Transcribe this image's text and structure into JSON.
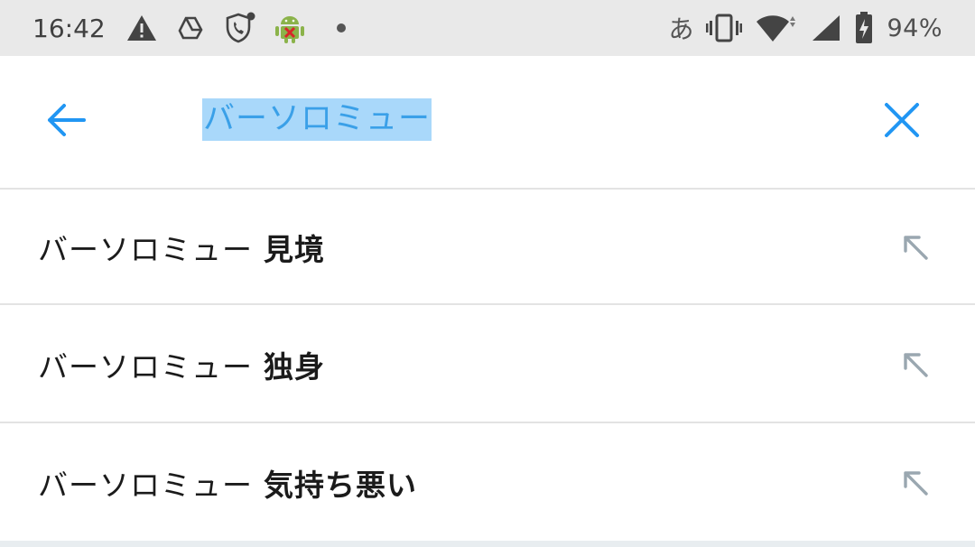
{
  "status_bar": {
    "time": "16:42",
    "left_icons": [
      "warning-icon",
      "drive-icon",
      "call-shield-icon",
      "android-debug-icon",
      "dot-icon"
    ],
    "ime_indicator": "あ",
    "right_icons": [
      "vibrate-icon",
      "wifi-icon",
      "signal-icon",
      "battery-charging-icon"
    ],
    "battery_percent": "94%"
  },
  "search": {
    "query": "バーソロミュー",
    "back_icon": "arrow-left-icon",
    "clear_icon": "close-icon",
    "accent_color": "#2196f3",
    "selection_color": "#a9d8fa"
  },
  "suggestions": [
    {
      "base": "バーソロミュー",
      "suffix": "見境",
      "fill_icon": "arrow-up-left-icon"
    },
    {
      "base": "バーソロミュー",
      "suffix": "独身",
      "fill_icon": "arrow-up-left-icon"
    },
    {
      "base": "バーソロミュー",
      "suffix": "気持ち悪い",
      "fill_icon": "arrow-up-left-icon"
    }
  ]
}
